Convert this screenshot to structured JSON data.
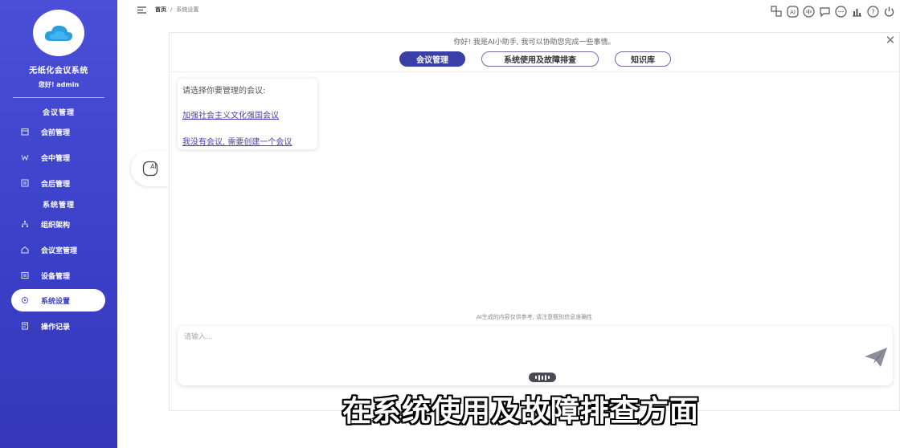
{
  "sidebar": {
    "app_title": "无纸化会议系统",
    "greeting": "您好! admin",
    "groups": {
      "meeting": "会议管理",
      "system": "系统管理"
    },
    "items": [
      {
        "label": "会前管理",
        "icon": "calendar-icon"
      },
      {
        "label": "会中管理",
        "icon": "meeting-icon"
      },
      {
        "label": "会后管理",
        "icon": "archive-icon"
      },
      {
        "label": "组织架构",
        "icon": "org-icon"
      },
      {
        "label": "会议室管理",
        "icon": "room-icon"
      },
      {
        "label": "设备管理",
        "icon": "device-icon"
      },
      {
        "label": "系统设置",
        "icon": "settings-icon",
        "active": true
      },
      {
        "label": "操作记录",
        "icon": "log-icon"
      }
    ]
  },
  "header": {
    "breadcrumb_home": "首页",
    "breadcrumb_sep": "/",
    "breadcrumb_current": "系统设置",
    "icons": [
      "translate-icon",
      "ai-icon",
      "voice-icon",
      "chat-icon",
      "message-icon",
      "stats-icon",
      "help-icon",
      "power-icon"
    ]
  },
  "ai_float": {
    "label": "AI"
  },
  "chat": {
    "hello": "你好! 我是AI小助手, 我可以协助您完成一些事情。",
    "tabs": [
      {
        "label": "会议管理",
        "active": true
      },
      {
        "label": "系统使用及故障排查",
        "active": false
      },
      {
        "label": "知识库",
        "active": false
      }
    ],
    "bubble": {
      "prompt": "请选择你要管理的会议:",
      "options": [
        "加强社会主义文化强国会议",
        "我没有会议, 需要创建一个会议"
      ]
    },
    "disclaimer": "AI生成的内容仅供参考, 请注意甄别信息准确性",
    "input_placeholder": "请输入..."
  },
  "subtitle": "在系统使用及故障排查方面",
  "colors": {
    "sidebar": "#3a3fc8",
    "accent": "#3a3fa8",
    "link": "#4a3fa8"
  }
}
